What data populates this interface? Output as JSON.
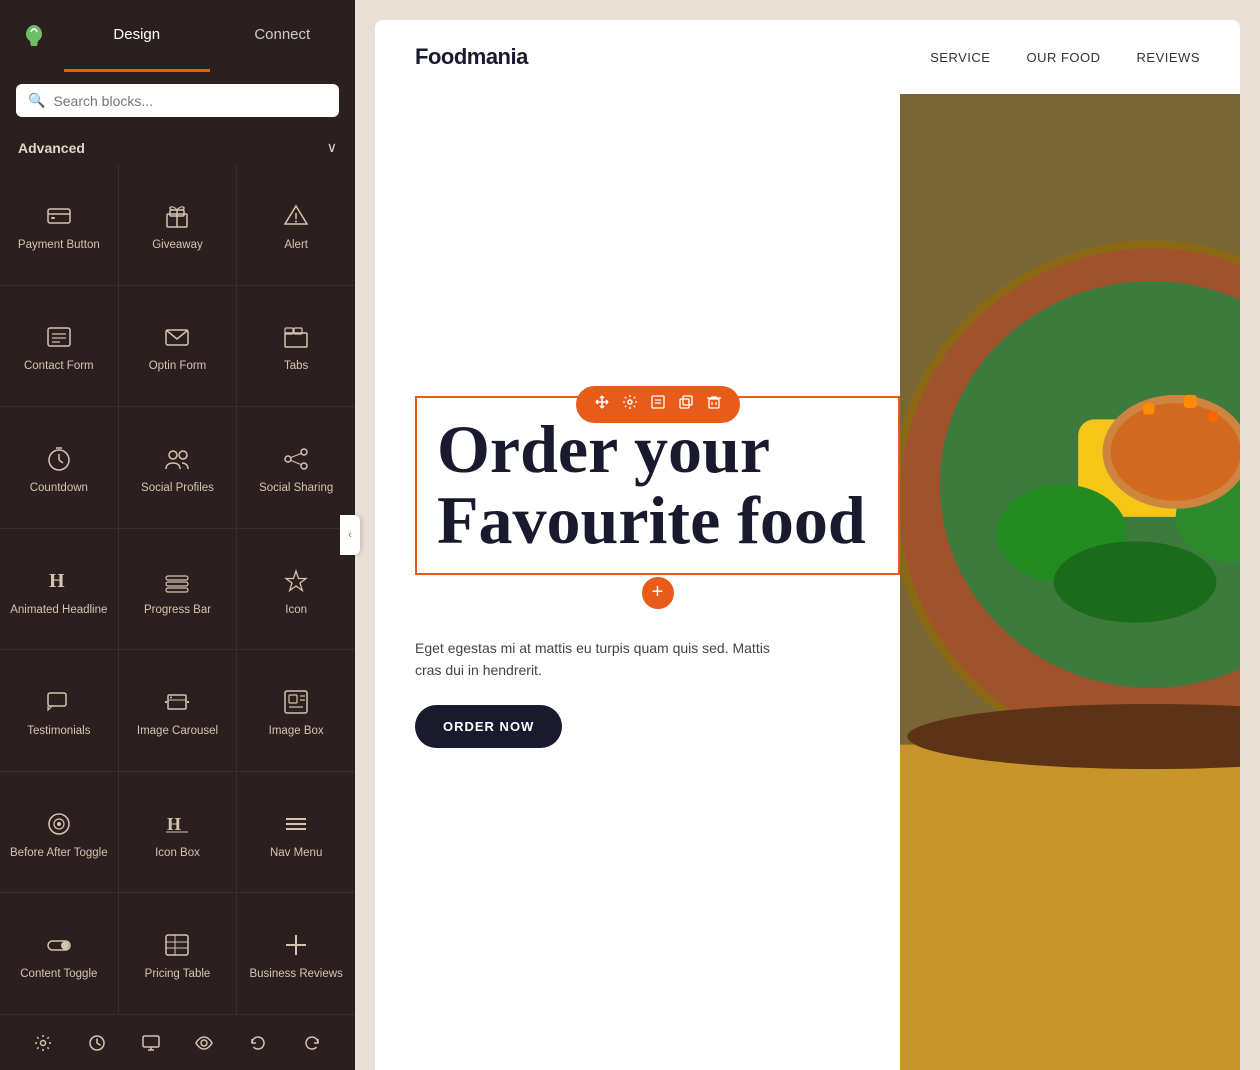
{
  "sidebar": {
    "tabs": [
      {
        "id": "design",
        "label": "Design",
        "active": true
      },
      {
        "id": "connect",
        "label": "Connect",
        "active": false
      }
    ],
    "search": {
      "placeholder": "Search blocks..."
    },
    "section": {
      "title": "Advanced",
      "collapsed": false
    },
    "blocks": [
      {
        "id": "payment-button",
        "label": "Payment Button",
        "icon": "💳"
      },
      {
        "id": "giveaway",
        "label": "Giveaway",
        "icon": "🎁"
      },
      {
        "id": "alert",
        "label": "Alert",
        "icon": "⚠️"
      },
      {
        "id": "contact-form",
        "label": "Contact Form",
        "icon": "📋"
      },
      {
        "id": "optin-form",
        "label": "Optin Form",
        "icon": "✉️"
      },
      {
        "id": "tabs",
        "label": "Tabs",
        "icon": "📑"
      },
      {
        "id": "countdown",
        "label": "Countdown",
        "icon": "⏱️"
      },
      {
        "id": "social-profiles",
        "label": "Social Profiles",
        "icon": "👥"
      },
      {
        "id": "social-sharing",
        "label": "Social Sharing",
        "icon": "↗️"
      },
      {
        "id": "animated-headline",
        "label": "Animated Headline",
        "icon": "H"
      },
      {
        "id": "progress-bar",
        "label": "Progress Bar",
        "icon": "≡"
      },
      {
        "id": "icon",
        "label": "Icon",
        "icon": "♥"
      },
      {
        "id": "testimonials",
        "label": "Testimonials",
        "icon": "💬"
      },
      {
        "id": "image-carousel",
        "label": "Image Carousel",
        "icon": "🖼️"
      },
      {
        "id": "image-box",
        "label": "Image Box",
        "icon": "🖼"
      },
      {
        "id": "before-after-toggle",
        "label": "Before After Toggle",
        "icon": "⊙"
      },
      {
        "id": "icon-box",
        "label": "Icon Box",
        "icon": "H"
      },
      {
        "id": "nav-menu",
        "label": "Nav Menu",
        "icon": "≡"
      },
      {
        "id": "content-toggle",
        "label": "Content Toggle",
        "icon": "⬤"
      },
      {
        "id": "pricing-table",
        "label": "Pricing Table",
        "icon": "📊"
      },
      {
        "id": "business-reviews",
        "label": "Business Reviews",
        "icon": "+"
      }
    ],
    "bottomIcons": [
      {
        "id": "settings",
        "icon": "⚙️"
      },
      {
        "id": "history",
        "icon": "🕐"
      },
      {
        "id": "desktop",
        "icon": "🖥️"
      },
      {
        "id": "preview",
        "icon": "👁️"
      },
      {
        "id": "undo",
        "icon": "↩️"
      },
      {
        "id": "redo",
        "icon": "↪️"
      }
    ]
  },
  "preview": {
    "nav": {
      "logo": "Foodmania",
      "links": [
        "SERVICE",
        "OUR FOOD",
        "REVIEWS"
      ]
    },
    "hero": {
      "headline": "Order your Favourite food",
      "description": "Eget egestas mi at mattis eu turpis quam quis sed. Mattis cras dui in hendrerit.",
      "cta": "ORDER NOW"
    },
    "toolbar": {
      "icons": [
        "✥",
        "⚙",
        "⊡",
        "⧉",
        "🗑"
      ]
    }
  },
  "colors": {
    "primary": "#e85c1a",
    "sidebar_bg": "#2c1f1f",
    "text_dark": "#1a1a2e",
    "gold": "#c8952a"
  }
}
